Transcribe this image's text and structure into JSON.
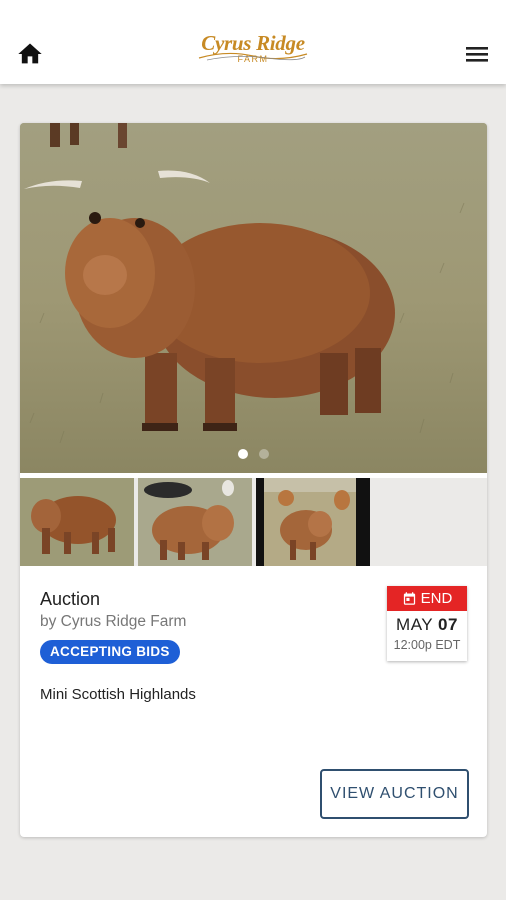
{
  "header": {
    "logo_main": "Cyrus Ridge",
    "logo_sub": "FARM",
    "home_icon": "home-icon",
    "menu_icon": "menu-icon"
  },
  "listing": {
    "image_dots": 2,
    "active_dot": 0,
    "thumbnails": 3,
    "title": "Auction",
    "byline": "by Cyrus Ridge Farm",
    "status_badge": "ACCEPTING BIDS",
    "description": "Mini Scottish Highlands",
    "end": {
      "label": "END",
      "month": "MAY",
      "day": "07",
      "time": "12:00p EDT"
    },
    "view_button": "VIEW AUCTION"
  },
  "colors": {
    "accent_blue": "#1e5fd6",
    "end_red": "#e42525",
    "button_border": "#2f4f6f",
    "logo_gold": "#c78a24"
  }
}
